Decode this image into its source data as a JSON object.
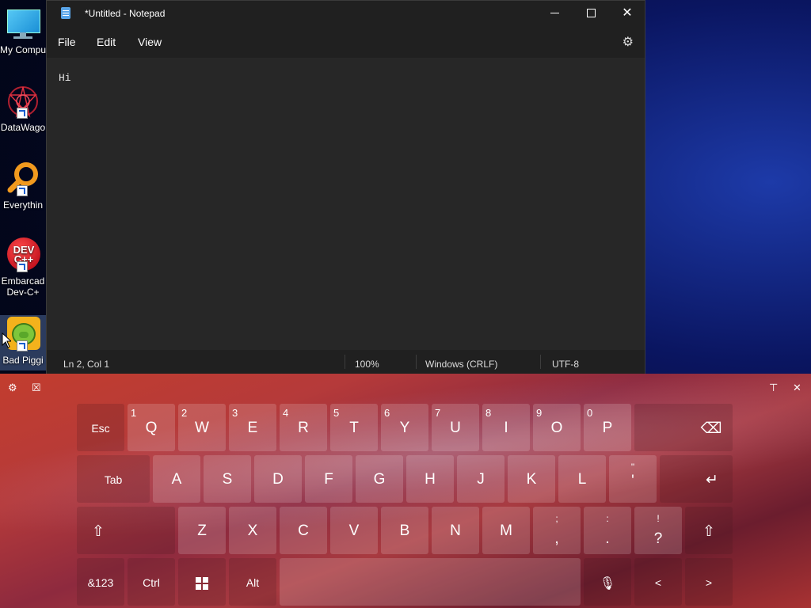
{
  "desktop": {
    "icons": [
      {
        "label": "My Compu"
      },
      {
        "label": "DataWago"
      },
      {
        "label": "Everythin"
      },
      {
        "label": "Embarcad\nDev-C+"
      },
      {
        "label": "Bad Piggi"
      }
    ]
  },
  "notepad": {
    "title": "*Untitled - Notepad",
    "menu": [
      "File",
      "Edit",
      "View"
    ],
    "content": "Hi",
    "status": {
      "position": "Ln 2, Col 1",
      "zoom": "100%",
      "line_ending": "Windows (CRLF)",
      "encoding": "UTF-8"
    }
  },
  "keyboard": {
    "row1": [
      {
        "label": "Esc"
      },
      {
        "label": "Q",
        "num": "1"
      },
      {
        "label": "W",
        "num": "2"
      },
      {
        "label": "E",
        "num": "3"
      },
      {
        "label": "R",
        "num": "4"
      },
      {
        "label": "T",
        "num": "5"
      },
      {
        "label": "Y",
        "num": "6"
      },
      {
        "label": "U",
        "num": "7"
      },
      {
        "label": "I",
        "num": "8"
      },
      {
        "label": "O",
        "num": "9"
      },
      {
        "label": "P",
        "num": "0"
      }
    ],
    "row2": [
      "Tab",
      "A",
      "S",
      "D",
      "F",
      "G",
      "H",
      "J",
      "K",
      "L"
    ],
    "quote": {
      "up": "\"",
      "low": "'"
    },
    "row3": [
      "Z",
      "X",
      "C",
      "V",
      "B",
      "N",
      "M"
    ],
    "punct": [
      {
        "up": ";",
        "low": ","
      },
      {
        "up": ":",
        "low": "."
      },
      {
        "up": "!",
        "low": "?"
      }
    ],
    "row4": {
      "sym": "&123",
      "ctrl": "Ctrl",
      "alt": "Alt"
    }
  },
  "colors": {
    "accent": "#5aa5e8",
    "window_bg": "#272727",
    "titlebar_bg": "#202020"
  }
}
